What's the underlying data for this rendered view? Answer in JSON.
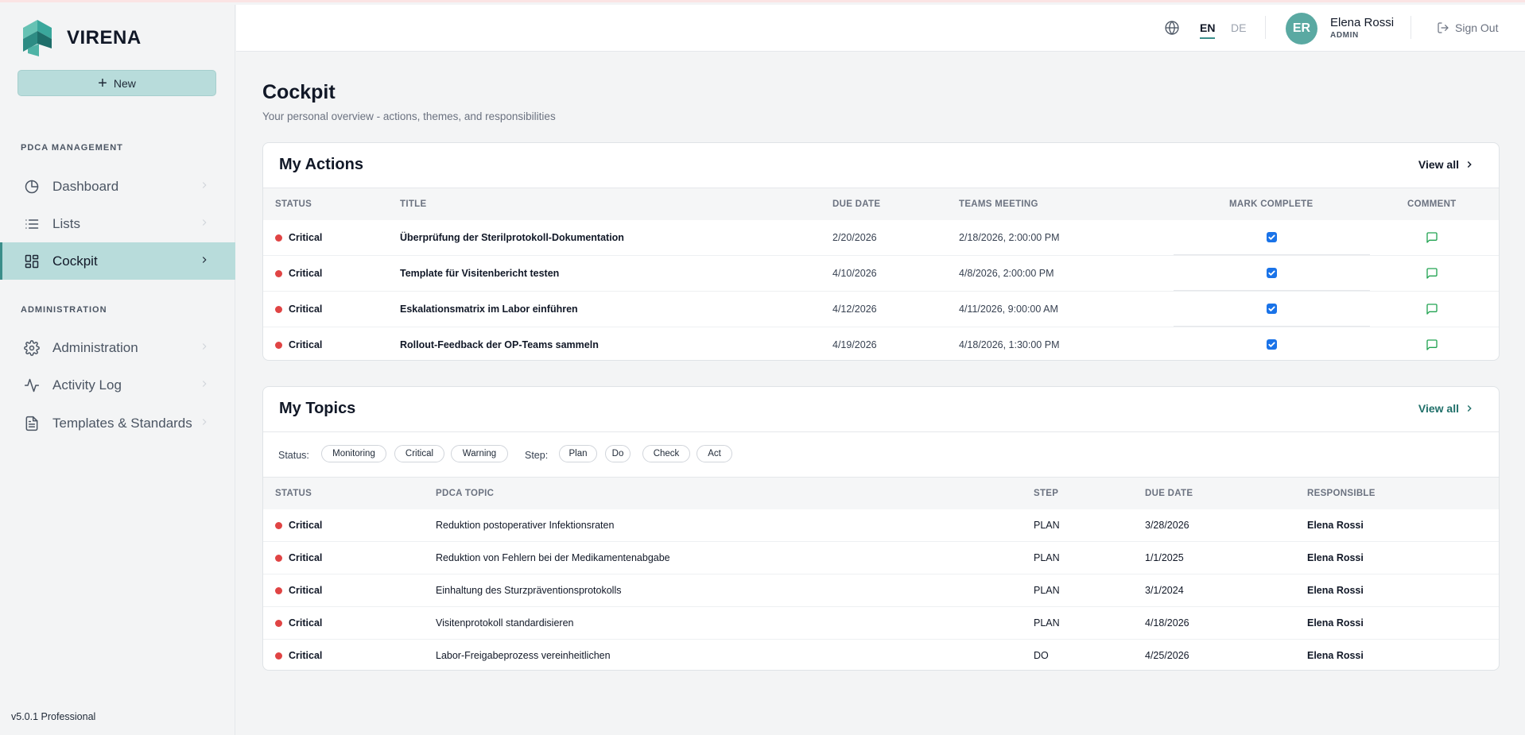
{
  "brand": {
    "name": "VIRENA",
    "accent": "#3a8e8a"
  },
  "sidebar": {
    "new_label": "New",
    "sections": [
      {
        "label": "PDCA MANAGEMENT"
      },
      {
        "label": "ADMINISTRATION"
      }
    ],
    "items": [
      {
        "label": "Dashboard",
        "icon": "pie-chart-icon",
        "active": false
      },
      {
        "label": "Lists",
        "icon": "list-icon",
        "active": false
      },
      {
        "label": "Cockpit",
        "icon": "layout-grid-icon",
        "active": true
      },
      {
        "label": "Administration",
        "icon": "gear-icon",
        "active": false
      },
      {
        "label": "Activity Log",
        "icon": "activity-icon",
        "active": false
      },
      {
        "label": "Templates & Standards",
        "icon": "document-icon",
        "active": false
      }
    ],
    "version": "v5.0.1 Professional"
  },
  "header": {
    "lang_en": "EN",
    "lang_de": "DE",
    "user": {
      "initials": "ER",
      "name": "Elena Rossi",
      "role": "ADMIN"
    },
    "signout_label": "Sign Out"
  },
  "page": {
    "title": "Cockpit",
    "subtitle": "Your personal overview - actions, themes, and responsibilities"
  },
  "actions": {
    "title": "My Actions",
    "view_all": "View all",
    "columns": [
      "STATUS",
      "TITLE",
      "DUE DATE",
      "TEAMS MEETING",
      "MARK COMPLETE",
      "COMMENT"
    ],
    "rows": [
      {
        "status": "Critical",
        "title": "Überprüfung der Sterilprotokoll-Dokumentation",
        "due": "2/20/2026",
        "meeting": "2/18/2026, 2:00:00 PM",
        "complete": true
      },
      {
        "status": "Critical",
        "title": "Template für Visitenbericht testen",
        "due": "4/10/2026",
        "meeting": "4/8/2026, 2:00:00 PM",
        "complete": true
      },
      {
        "status": "Critical",
        "title": "Eskalationsmatrix im Labor einführen",
        "due": "4/12/2026",
        "meeting": "4/11/2026, 9:00:00 AM",
        "complete": true
      },
      {
        "status": "Critical",
        "title": "Rollout-Feedback der OP-Teams sammeln",
        "due": "4/19/2026",
        "meeting": "4/18/2026, 1:30:00 PM",
        "complete": true
      }
    ]
  },
  "topics": {
    "title": "My Topics",
    "view_all": "View all",
    "status_label": "Status:",
    "status_filters": [
      "Monitoring",
      "Critical",
      "Warning"
    ],
    "step_label": "Step:",
    "step_filters": [
      "Plan",
      "Do",
      "Check",
      "Act"
    ],
    "columns": [
      "STATUS",
      "PDCA TOPIC",
      "STEP",
      "DUE DATE",
      "RESPONSIBLE"
    ],
    "rows": [
      {
        "status": "Critical",
        "topic": "Reduktion postoperativer Infektionsraten",
        "step": "PLAN",
        "due": "3/28/2026",
        "responsible": "Elena Rossi"
      },
      {
        "status": "Critical",
        "topic": "Reduktion von Fehlern bei der Medikamentenabgabe",
        "step": "PLAN",
        "due": "1/1/2025",
        "responsible": "Elena Rossi"
      },
      {
        "status": "Critical",
        "topic": "Einhaltung des Sturzpräventionsprotokolls",
        "step": "PLAN",
        "due": "3/1/2024",
        "responsible": "Elena Rossi"
      },
      {
        "status": "Critical",
        "topic": "Visitenprotokoll standardisieren",
        "step": "PLAN",
        "due": "4/18/2026",
        "responsible": "Elena Rossi"
      },
      {
        "status": "Critical",
        "topic": "Labor-Freigabeprozess vereinheitlichen",
        "step": "DO",
        "due": "4/25/2026",
        "responsible": "Elena Rossi"
      }
    ]
  },
  "colors": {
    "critical": "#e04444",
    "active_bg": "#b8dcdb",
    "comment": "#22a352",
    "checkbox": "#1a73e8"
  }
}
